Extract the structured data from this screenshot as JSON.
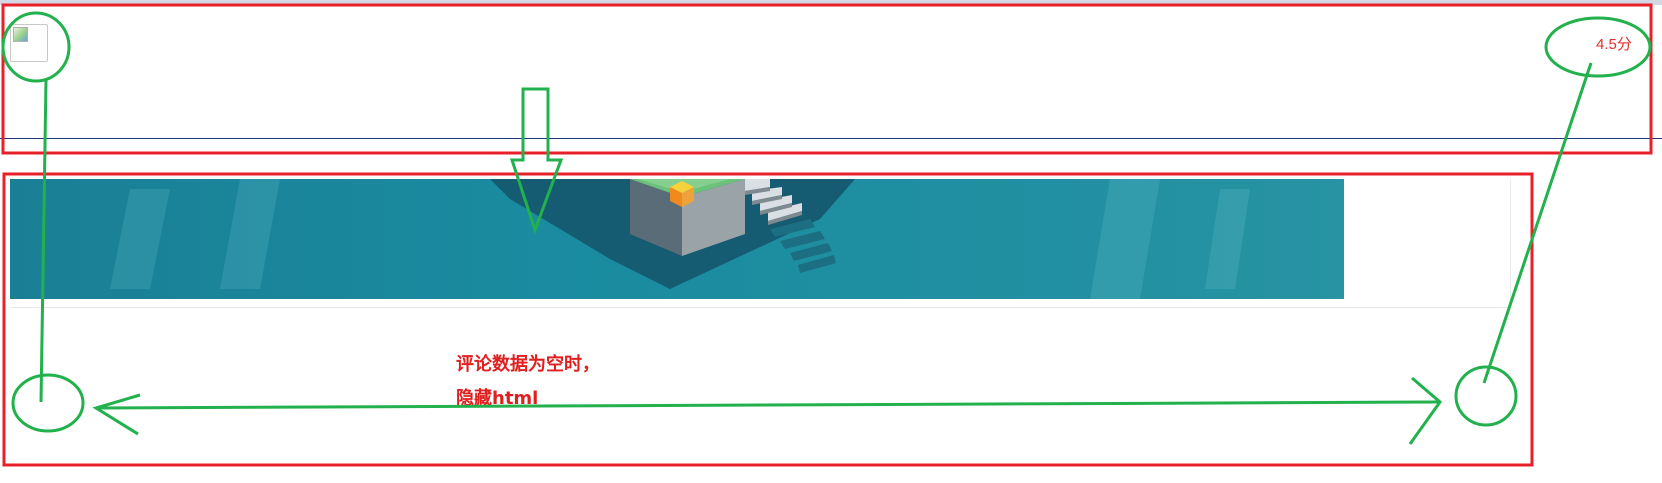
{
  "header": {
    "rating_text": "4.5分",
    "logo_icon": "broken-image-icon"
  },
  "banner": {
    "image_icon": "isometric-tower-illustration",
    "background_color": "#1a8ba0"
  },
  "comments": {
    "empty_note_line1": "评论数据为空时，",
    "empty_note_line2": "隐藏html"
  },
  "annotation_colors": {
    "box_red": "#e8202a",
    "marker_green": "#22b14c",
    "note_red": "#e02020"
  }
}
